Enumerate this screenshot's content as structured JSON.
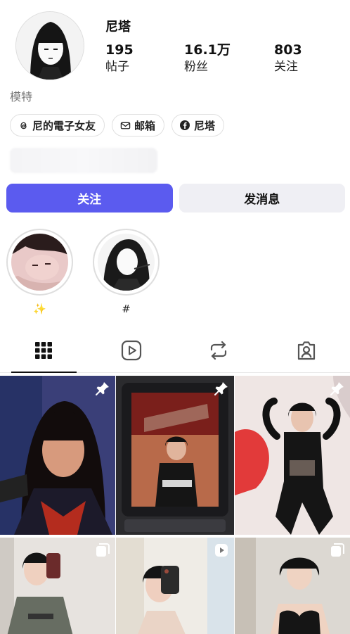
{
  "profile": {
    "username": "尼塔",
    "bio": "模特",
    "stats": [
      {
        "value": "195",
        "label": "帖子"
      },
      {
        "value": "16.1万",
        "label": "粉丝"
      },
      {
        "value": "803",
        "label": "关注"
      }
    ]
  },
  "chips": [
    {
      "icon": "threads-icon",
      "label": "尼的電子女友"
    },
    {
      "icon": "mail-icon",
      "label": "邮箱"
    },
    {
      "icon": "facebook-icon",
      "label": "尼塔"
    }
  ],
  "actions": {
    "follow": "关注",
    "message": "发消息"
  },
  "highlights": [
    {
      "label": "✨"
    },
    {
      "label": "#"
    }
  ],
  "tabs": [
    {
      "icon": "grid-icon",
      "active": true
    },
    {
      "icon": "reels-icon",
      "active": false
    },
    {
      "icon": "reposts-icon",
      "active": false
    },
    {
      "icon": "tagged-icon",
      "active": false
    }
  ],
  "posts": [
    {
      "badge": "pin-icon"
    },
    {
      "badge": "pin-icon"
    },
    {
      "badge": "pin-icon"
    },
    {
      "badge": "carousel-icon"
    },
    {
      "badge": "reel-icon"
    },
    {
      "badge": "carousel-icon"
    }
  ],
  "colors": {
    "accent": "#5b5bef",
    "secondary_button": "#efeff4",
    "muted_text": "#777777"
  }
}
